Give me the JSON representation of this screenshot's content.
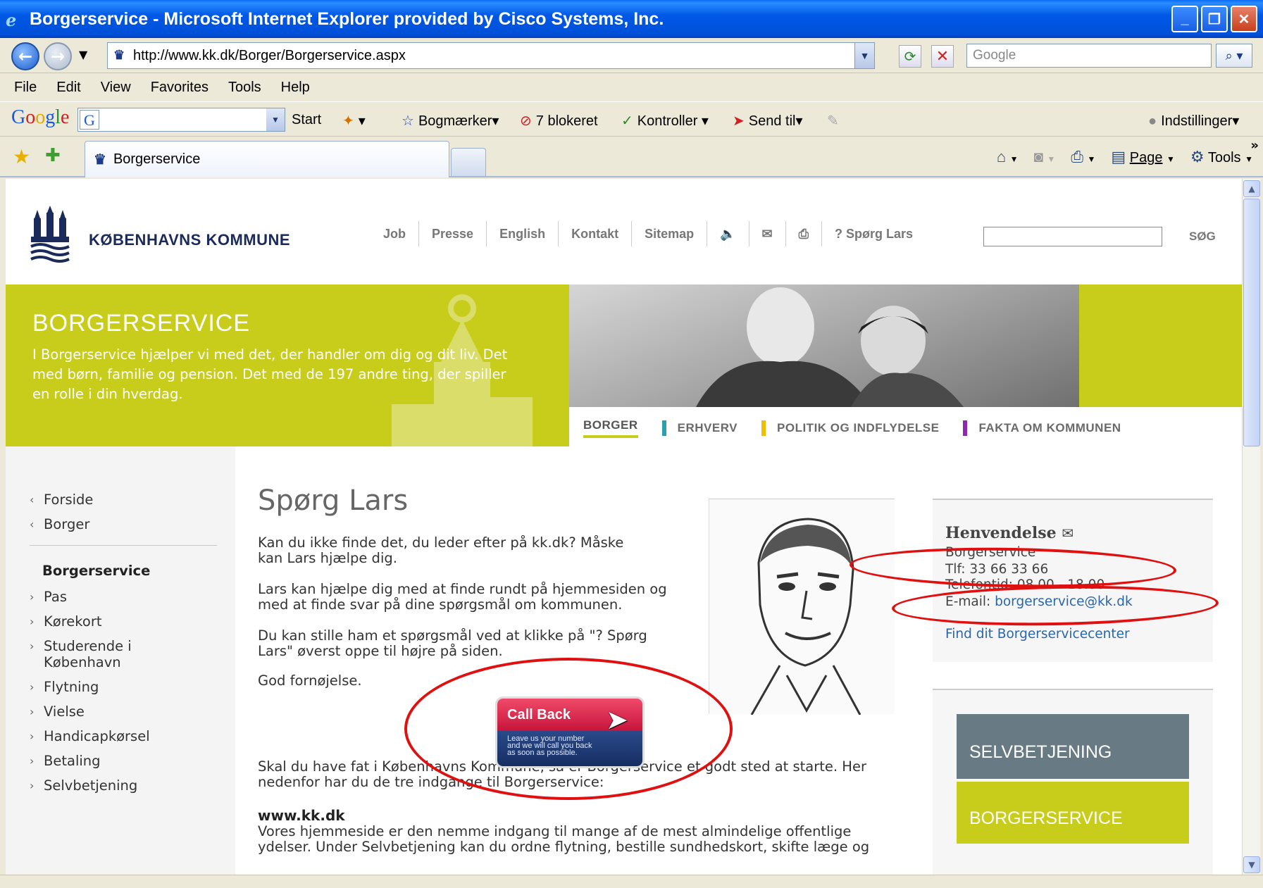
{
  "window": {
    "title": "Borgerservice - Microsoft Internet Explorer provided by Cisco Systems, Inc."
  },
  "address": {
    "url": "http://www.kk.dk/Borger/Borgerservice.aspx",
    "search_placeholder": "Google"
  },
  "menu": [
    "File",
    "Edit",
    "View",
    "Favorites",
    "Tools",
    "Help"
  ],
  "googlebar": {
    "start": "Start",
    "bookmarks": "Bogmærker",
    "blocked": "7 blokeret",
    "check": "Kontroller",
    "send": "Send til",
    "settings": "Indstillinger"
  },
  "tabs": {
    "active": "Borgerservice",
    "page_label": "Page",
    "tools_label": "Tools"
  },
  "site": {
    "logo_text": "KØBENHAVNS KOMMUNE",
    "topnav": [
      "Job",
      "Presse",
      "English",
      "Kontakt",
      "Sitemap"
    ],
    "ask_lars": "? Spørg Lars",
    "search_button": "SØG"
  },
  "hero": {
    "title": "BORGERSERVICE",
    "desc": "I Borgerservice hjælper vi med det, der handler om dig og dit liv. Det med børn, familie og pension. Det med de 197 andre ting, der spiller en rolle i din hverdag."
  },
  "mainnav": [
    {
      "label": "BORGER",
      "color": "#c8cc1a"
    },
    {
      "label": "ERHVERV",
      "color": "#2aa0b0"
    },
    {
      "label": "POLITIK OG INDFLYDELSE",
      "color": "#f0c000"
    },
    {
      "label": "FAKTA OM KOMMUNEN",
      "color": "#8a2ab0"
    }
  ],
  "leftnav": {
    "back_items": [
      "Forside",
      "Borger"
    ],
    "heading": "Borgerservice",
    "items": [
      "Pas",
      "Kørekort",
      "Studerende i København",
      "Flytning",
      "Vielse",
      "Handicapkørsel",
      "Betaling",
      "Selvbetjening"
    ]
  },
  "content": {
    "title": "Spørg Lars",
    "p1": "Kan du ikke finde det, du leder efter på kk.dk? Måske kan Lars hjælpe dig.",
    "p2": "Lars kan hjælpe dig med at finde rundt på hjemmesiden og med at finde svar på dine spørgsmål om kommunen.",
    "p3": "Du kan stille ham et spørgsmål ved at klikke på \"? Spørg Lars\" øverst oppe til højre på siden.",
    "p4": "God fornøjelse.",
    "p5": "Skal du have fat i Københavns Kommune, så er Borgerservice et godt sted at starte. Her nedenfor har du de tre indgange til Borgerservice:",
    "h_www": "www.kk.dk",
    "p6": "Vores hjemmeside er den nemme indgang til mange af de mest almindelige offentlige ydelser. Under Selvbetjening kan du ordne flytning, bestille sundhedskort, skifte læge og"
  },
  "callback": {
    "title": "Call Back",
    "line1": "Leave us your number",
    "line2": "and we will call you back",
    "line3": "as soon as possible."
  },
  "contact": {
    "title": "Henvendelse",
    "org": "Borgerservice",
    "phone": "Tlf: 33 66 33 66",
    "hours": "Telefontid: 08.00 - 18.00",
    "email_label": "E-mail: ",
    "email": "borgerservice@kk.dk",
    "find": "Find dit Borgerservicecenter"
  },
  "selfservice": {
    "label1": "SELVBETJENING",
    "label2": "BORGERSERVICE"
  }
}
